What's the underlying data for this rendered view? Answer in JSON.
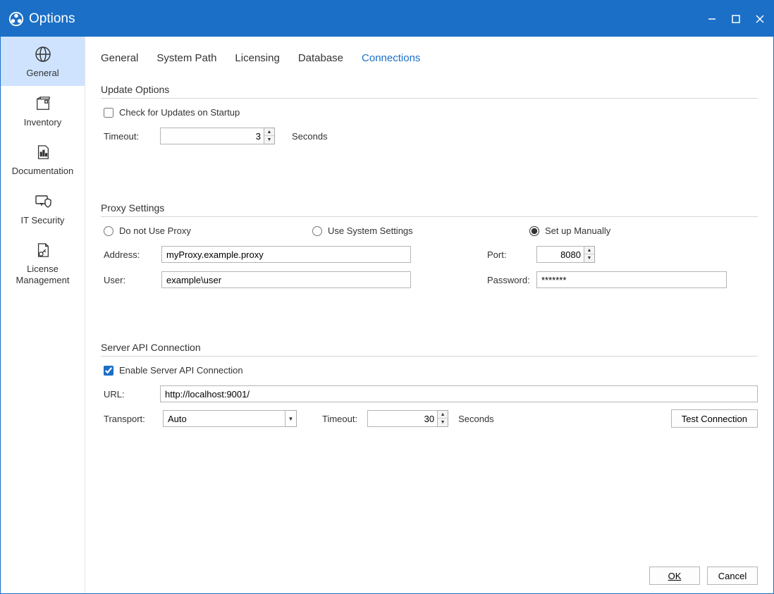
{
  "title": "Options",
  "sidebar": {
    "items": [
      {
        "label": "General",
        "icon": "globe-icon",
        "active": true
      },
      {
        "label": "Inventory",
        "icon": "box-icon",
        "active": false
      },
      {
        "label": "Documentation",
        "icon": "chart-doc-icon",
        "active": false
      },
      {
        "label": "IT Security",
        "icon": "shield-icon",
        "active": false
      },
      {
        "label": "License\nManagement",
        "icon": "license-icon",
        "active": false
      }
    ]
  },
  "tabs": [
    {
      "label": "General",
      "active": false
    },
    {
      "label": "System Path",
      "active": false
    },
    {
      "label": "Licensing",
      "active": false
    },
    {
      "label": "Database",
      "active": false
    },
    {
      "label": "Connections",
      "active": true
    }
  ],
  "updateOptions": {
    "title": "Update Options",
    "checkUpdatesLabel": "Check for Updates on Startup",
    "checkUpdatesChecked": false,
    "timeoutLabel": "Timeout:",
    "timeoutValue": "3",
    "timeoutUnit": "Seconds"
  },
  "proxy": {
    "title": "Proxy Settings",
    "radios": {
      "noProxy": "Do not Use Proxy",
      "system": "Use System Settings",
      "manual": "Set up Manually",
      "selected": "manual"
    },
    "addressLabel": "Address:",
    "addressValue": "myProxy.example.proxy",
    "portLabel": "Port:",
    "portValue": "8080",
    "userLabel": "User:",
    "userValue": "example\\user",
    "passwordLabel": "Password:",
    "passwordValue": "*******"
  },
  "api": {
    "title": "Server API Connection",
    "enableLabel": "Enable Server API Connection",
    "enableChecked": true,
    "urlLabel": "URL:",
    "urlValue": "http://localhost:9001/",
    "transportLabel": "Transport:",
    "transportValue": "Auto",
    "timeoutLabel": "Timeout:",
    "timeoutValue": "30",
    "timeoutUnit": "Seconds",
    "testButton": "Test Connection"
  },
  "footer": {
    "ok": "OK",
    "cancel": "Cancel"
  }
}
